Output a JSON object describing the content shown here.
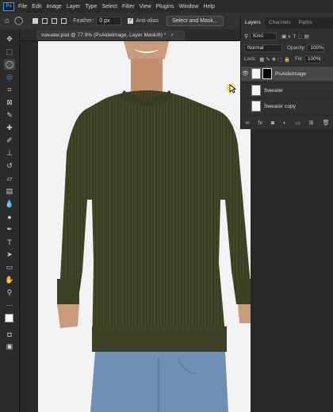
{
  "app": {
    "logo": "Ps"
  },
  "menu": [
    "File",
    "Edit",
    "Image",
    "Layer",
    "Type",
    "Select",
    "Filter",
    "View",
    "Plugins",
    "Window",
    "Help"
  ],
  "options": {
    "feather_label": "Feather:",
    "feather_value": "0 px",
    "antialias_label": "Anti-alias",
    "select_mask_button": "Select and Mask..."
  },
  "document": {
    "tab_title": "sweater.psd @ 77.9% (PsAideImage, Layer Mask/8) *",
    "close": "×"
  },
  "layers_panel": {
    "tabs": [
      "Layers",
      "Channels",
      "Paths"
    ],
    "filter_value": "Kind",
    "blend_mode": "Normal",
    "opacity_label": "Opacity:",
    "opacity_value": "100%",
    "lock_label": "Lock:",
    "fill_label": "Fill:",
    "fill_value": "100%",
    "layers": [
      {
        "name": "PsAideImage",
        "visible": true,
        "selected": true,
        "has_mask": true
      },
      {
        "name": "Sweater",
        "visible": false,
        "selected": false,
        "has_mask": false
      },
      {
        "name": "Sweater copy",
        "visible": false,
        "selected": false,
        "has_mask": false
      }
    ]
  },
  "colors": {
    "sweater": "#434628",
    "jeans": "#6f8fb4",
    "skin": "#c99a7b",
    "accent": "#31a8ff"
  }
}
